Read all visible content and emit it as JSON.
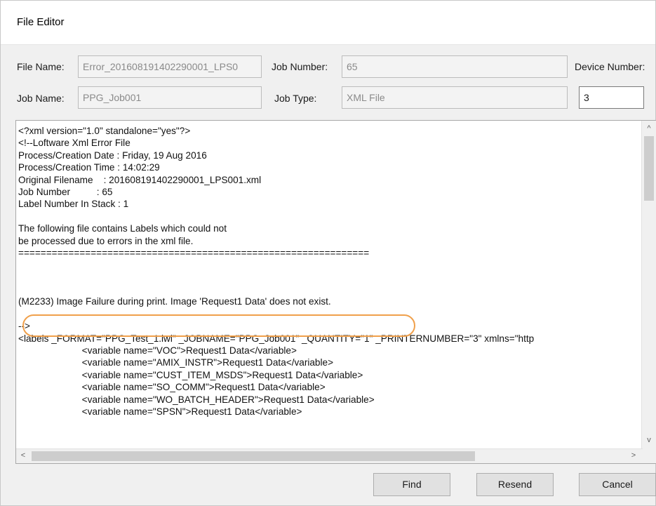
{
  "window": {
    "title": "File Editor"
  },
  "header": {
    "file_name_label": "File Name:",
    "file_name_value": "Error_201608191402290001_LPS0",
    "job_number_label": "Job Number:",
    "job_number_value": "65",
    "device_number_label": "Device Number:",
    "device_number_value": "3",
    "job_name_label": "Job Name:",
    "job_name_value": "PPG_Job001",
    "job_type_label": "Job Type:",
    "job_type_value": "XML File"
  },
  "editor": {
    "lines": [
      "<?xml version=\"1.0\" standalone=\"yes\"?>",
      "<!--Loftware Xml Error File",
      "Process/Creation Date : Friday, 19 Aug 2016",
      "Process/Creation Time : 14:02:29",
      "Original Filename    : 201608191402290001_LPS001.xml",
      "Job Number          : 65",
      "Label Number In Stack : 1",
      "",
      "The following file contains Labels which could not",
      "be processed due to errors in the xml file.",
      "===============================================================",
      "",
      "",
      "",
      "(M2233) Image Failure during print. Image 'Request1 Data' does not exist.",
      "",
      "-->",
      "<labels _FORMAT=\"PPG_Test_1.lwl\" _JOBNAME=\"PPG_Job001\" _QUANTITY=\"1\" _PRINTERNUMBER=\"3\" xmlns=\"http",
      "                        <variable name=\"VOC\">Request1 Data</variable>",
      "                        <variable name=\"AMIX_INSTR\">Request1 Data</variable>",
      "                        <variable name=\"CUST_ITEM_MSDS\">Request1 Data</variable>",
      "                        <variable name=\"SO_COMM\">Request1 Data</variable>",
      "                        <variable name=\"WO_BATCH_HEADER\">Request1 Data</variable>",
      "                        <variable name=\"SPSN\">Request1 Data</variable>"
    ]
  },
  "scroll": {
    "up_arrow": "^",
    "down_arrow": "v",
    "left_arrow": "<",
    "right_arrow": ">"
  },
  "buttons": {
    "find": "Find",
    "resend": "Resend",
    "cancel": "Cancel"
  },
  "colors": {
    "highlight": "#f0a04b"
  }
}
